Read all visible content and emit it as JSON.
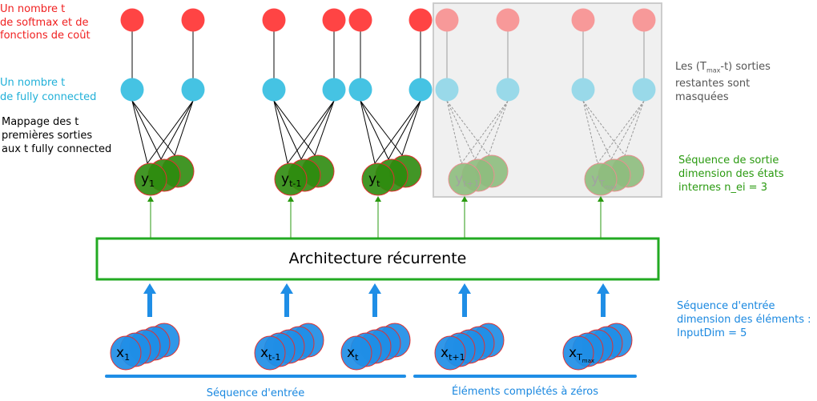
{
  "left_labels": {
    "softmax": [
      "Un nombre t",
      "de softmax et de",
      "fonctions de coût"
    ],
    "fully_connected": [
      "Un nombre t",
      "de fully connected"
    ],
    "mapping": [
      "Mappage des t",
      "premières sorties",
      "aux t fully connected"
    ]
  },
  "right_labels": {
    "masked": {
      "prefix": "Les (T",
      "sub": "max",
      "suffix": "-t) sorties",
      "lines": [
        "restantes sont",
        "masquées"
      ]
    },
    "output_seq": [
      "Séquence de sortie",
      "dimension des états",
      "internes n_ei = 3"
    ],
    "input_seq": [
      "Séquence d'entrée",
      "dimension des éléments :",
      "InputDim = 5"
    ]
  },
  "architecture_label": "Architecture récurrente",
  "outputs": [
    {
      "base": "y",
      "sub": "1",
      "masked": false
    },
    {
      "base": "y",
      "sub": "t-1",
      "masked": false
    },
    {
      "base": "y",
      "sub": "t",
      "masked": false
    },
    {
      "base": "y",
      "sub": "t+1",
      "masked": true
    },
    {
      "base": "y",
      "sub": "T",
      "subsub": "max",
      "masked": true
    }
  ],
  "inputs": [
    {
      "base": "x",
      "sub": "1"
    },
    {
      "base": "x",
      "sub": "t-1"
    },
    {
      "base": "x",
      "sub": "t"
    },
    {
      "base": "x",
      "sub": "t+1"
    },
    {
      "base": "x",
      "sub": "T",
      "subsub": "max"
    }
  ],
  "bottom_labels": {
    "input_sequence": "Séquence d'entrée",
    "zero_padded": "Éléments complétés à zéros"
  },
  "colors": {
    "softmax": "#ff4444",
    "fc": "#45c3e3",
    "output": "#2e8b0e",
    "input": "#1f8ee6",
    "frame": "#22aa22",
    "mask": "#f0f0f0"
  }
}
